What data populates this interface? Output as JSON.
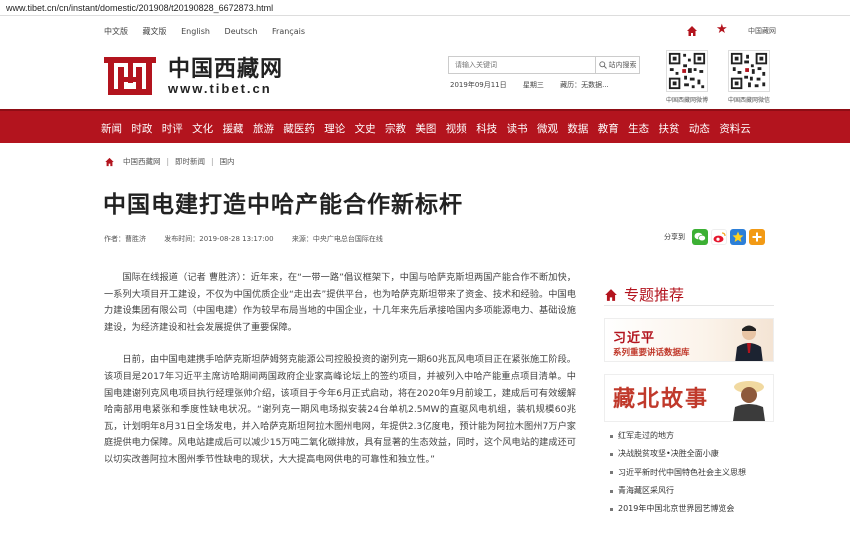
{
  "url": "www.tibet.cn/cn/instant/domestic/201908/t20190828_6672873.html",
  "header": {
    "languages": [
      "中文版",
      "藏文版",
      "English",
      "Deutsch",
      "Français"
    ],
    "mobile_label": "中国藏网",
    "logo_cn": "中国西藏网",
    "logo_en": "www.tibet.cn",
    "search_placeholder": "请输入关键词",
    "search_button": "站内搜索",
    "date": "2019年09月11日",
    "weekday": "星期三",
    "weather": "藏历：无数据...",
    "qr1_label": "中国西藏网微博",
    "qr2_label": "中国西藏网微信"
  },
  "nav": [
    "新闻",
    "时政",
    "时评",
    "文化",
    "援藏",
    "旅游",
    "藏医药",
    "理论",
    "文史",
    "宗教",
    "美图",
    "视频",
    "科技",
    "读书",
    "微观",
    "数据",
    "教育",
    "生态",
    "扶贫",
    "动态",
    "资料云"
  ],
  "breadcrumb": [
    "中国西藏网",
    "即时新闻",
    "国内"
  ],
  "article": {
    "title": "中国电建打造中哈产能合作新标杆",
    "author": "作者：曹胜济",
    "time": "发布时间：2019-08-28 13:17:00",
    "source": "来源：中央广电总台国际在线",
    "share_label": "分享到",
    "paragraphs": [
      "国际在线报道（记者 曹胜济）：近年来，在“一带一路”倡议框架下，中国与哈萨克斯坦两国产能合作不断加快，一系列大项目开工建设，不仅为中国优质企业“走出去”提供平台，也为哈萨克斯坦带来了资金、技术和经验。中国电力建设集团有限公司（中国电建）作为较早布局当地的中国企业，十几年来先后承接哈国内多项能源电力、基础设施建设，为经济建设和社会发展提供了重要保障。",
      "日前，由中国电建携手哈萨克斯坦萨姆努克能源公司控股投资的谢列克一期60兆瓦风电项目正在紧张施工阶段。该项目是2017年习近平主席访哈期间两国政府企业家高峰论坛上的签约项目，并被列入中哈产能重点项目清单。中国电建谢列克风电项目执行经理张帅介绍，该项目于今年6月正式启动，将在2020年9月前竣工，建成后可有效缓解哈南部用电紧张和季度性缺电状况。“谢列克一期风电场拟安装24台单机2.5MW的直驱风电机组，装机规模60兆瓦，计划明年8月31日全场发电，并入哈萨克斯坦阿拉木图州电网，年提供2.3亿度电，预计能为阿拉木图州7万户家庭提供电力保障。风电站建成后可以减少15万吨二氧化碳排放，具有显著的生态效益，同时，这个风电站的建成还可以切实改善阿拉木图州季节性缺电的现状，大大提高电网供电的可靠性和独立性。”"
    ]
  },
  "sidebar": {
    "title": "专题推荐",
    "banner1_main": "习近平",
    "banner1_sub": "系列重要讲话数据库",
    "banner2_main": "藏北故事",
    "topics": [
      "红军走过的地方",
      "决战脱贫攻坚•决胜全面小康",
      "习近平新时代中国特色社会主义思想",
      "青海藏区采风行",
      "2019年中国北京世界园艺博览会"
    ]
  },
  "colors": {
    "brand_red": "#b3141e"
  }
}
